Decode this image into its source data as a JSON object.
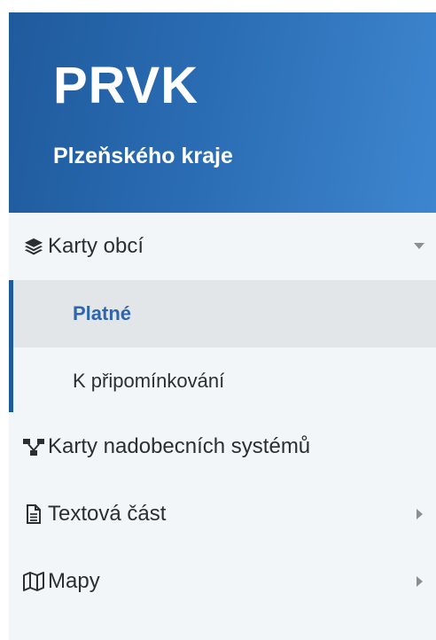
{
  "header": {
    "title": "PRVK",
    "subtitle": "Plzeňského kraje"
  },
  "menu": {
    "items": [
      {
        "label": "Karty obcí",
        "icon": "layers-icon",
        "expanded": true,
        "children": [
          {
            "label": "Platné",
            "active": true
          },
          {
            "label": "K připomínkování",
            "active": false
          }
        ]
      },
      {
        "label": "Karty nadobecních systémů",
        "icon": "network-icon"
      },
      {
        "label": "Textová část",
        "icon": "document-icon",
        "has_submenu": true
      },
      {
        "label": "Mapy",
        "icon": "map-icon",
        "has_submenu": true
      }
    ]
  },
  "colors": {
    "header_start": "#1f5a9c",
    "header_end": "#3d86cf",
    "active_text": "#2d66ad",
    "active_bg": "#e3e6e9",
    "menu_bg": "#f3f6f9",
    "accent": "#1f5a9c"
  }
}
